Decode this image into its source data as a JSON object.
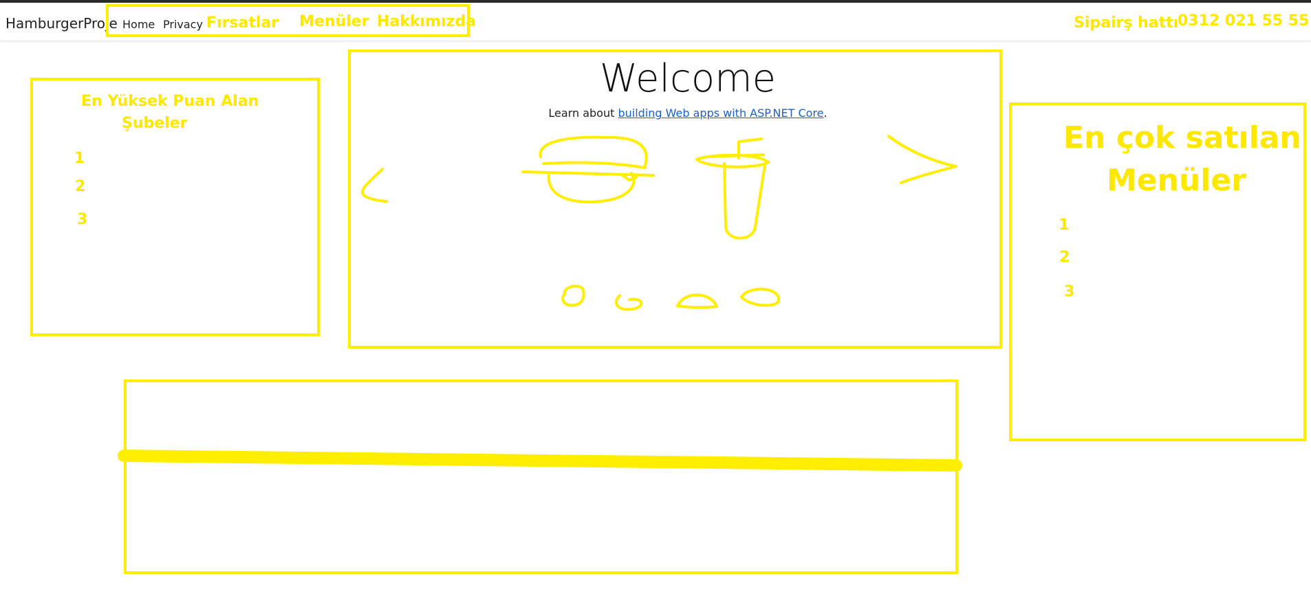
{
  "navbar": {
    "brand": "HamburgerProje",
    "home": "Home",
    "privacy": "Privacy",
    "deals": "Fırsatlar",
    "menus": "Menüler",
    "about": "Hakkımızda",
    "order_line_label": "Sipairş hattı",
    "order_line_phone": "0312 021 55 55"
  },
  "main": {
    "title": "Welcome",
    "learn_prefix": "Learn about ",
    "learn_link": "building Web apps with ASP.NET Core",
    "learn_suffix": "."
  },
  "left_panel": {
    "title_line1": "En Yüksek Puan Alan",
    "title_line2": "Şubeler",
    "items": [
      "1",
      "2",
      "3"
    ]
  },
  "right_panel": {
    "title_line1": "En çok satılan",
    "title_line2": "Menüler",
    "items": [
      "1",
      "2",
      "3"
    ]
  },
  "colors": {
    "highlight": "#ffee00",
    "link": "#1a5fd6",
    "text": "#222222"
  }
}
